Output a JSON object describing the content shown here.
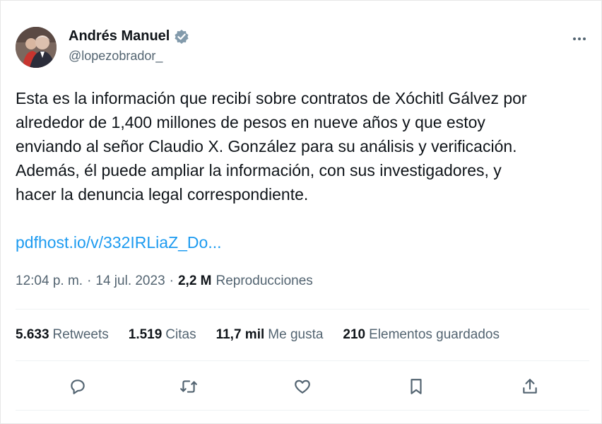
{
  "author": {
    "name": "Andrés Manuel",
    "handle": "@lopezobrador_",
    "verified_color": "#829aab"
  },
  "tweet": {
    "text": "Esta es la información que recibí sobre contratos de Xóchitl Gálvez por\nalrededor de 1,400 millones de pesos en nueve años y que estoy\nenviando al señor Claudio X. González para su análisis y verificación.\nAdemás, él puede ampliar la información, con sus investigadores, y\nhacer la denuncia legal correspondiente.",
    "link": "pdfhost.io/v/332IRLiaZ_Do...",
    "link_color": "#1d9bf0"
  },
  "meta": {
    "time": "12:04 p. m.",
    "separator": "·",
    "date": "14 jul. 2023",
    "views_count": "2,2 M",
    "views_label": "Reproducciones"
  },
  "stats": [
    {
      "count": "5.633",
      "label": "Retweets"
    },
    {
      "count": "1.519",
      "label": "Citas"
    },
    {
      "count": "11,7 mil",
      "label": "Me gusta"
    },
    {
      "count": "210",
      "label": "Elementos guardados"
    }
  ],
  "actions": [
    "reply-icon",
    "retweet-icon",
    "like-icon",
    "bookmark-icon",
    "share-icon"
  ]
}
